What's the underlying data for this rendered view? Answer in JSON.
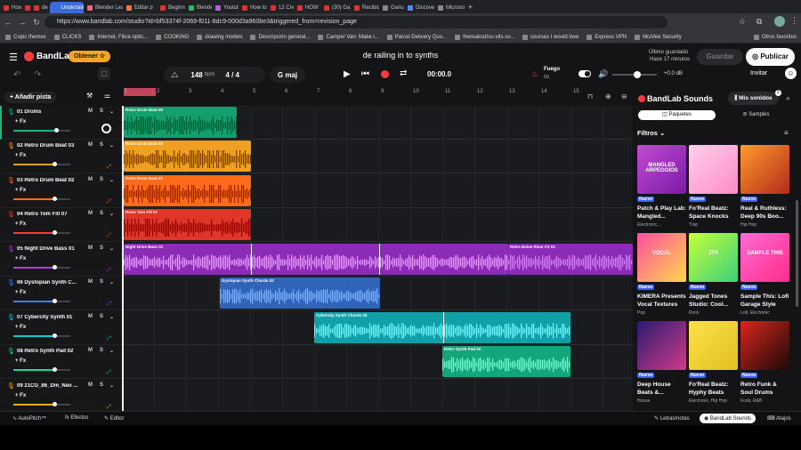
{
  "browser": {
    "tabs": [
      {
        "title": "How To",
        "color": "#d33"
      },
      {
        "title": "",
        "color": "#d33"
      },
      {
        "title": "de",
        "color": "#d33"
      },
      {
        "title": "Undertale DS",
        "color": "#3b6bd6",
        "active": true
      },
      {
        "title": "Blender Learn",
        "color": "#e67"
      },
      {
        "title": "Editar p",
        "color": "#e74"
      },
      {
        "title": "Beginne",
        "color": "#d33"
      },
      {
        "title": "Blender",
        "color": "#2b6"
      },
      {
        "title": "Youtube",
        "color": "#a6c"
      },
      {
        "title": "How to",
        "color": "#d33"
      },
      {
        "title": "12 Crea",
        "color": "#d33"
      },
      {
        "title": "HOW T",
        "color": "#d33"
      },
      {
        "title": "(30) Ga",
        "color": "#d33"
      },
      {
        "title": "Recibido",
        "color": "#d33"
      },
      {
        "title": "Ganu",
        "color": "#888"
      },
      {
        "title": "Discove",
        "color": "#58f"
      },
      {
        "title": "Microso",
        "color": "#888"
      }
    ],
    "url": "https://www.bandlab.com/studio?id=bf53374f-2069-f011-8dc9-000d3a960be3&triggered_from=revision_page",
    "bookmarks": [
      "Copic themes",
      "CLICKS",
      "Internet, Fibra óptic...",
      "COOKING",
      "drawing models",
      "Descripción general...",
      "Camper Van: Make i...",
      "Parcel Delivery Quo...",
      "thereaksd/so-vits-sv...",
      "courses I would love",
      "Express VPN",
      "McAfee Security"
    ],
    "other_bookmarks": "Otros favoritos"
  },
  "app": {
    "logo": "BandLab",
    "get_label": "Obtener",
    "bpm": "148",
    "bpm_unit": "bpm",
    "time_sig": "4 / 4",
    "key": "G maj",
    "time": "00:00.0",
    "project_title": "de railing in to synths",
    "save_status_1": "Último guardado",
    "save_status_2": "Hace 17 minutos",
    "save_label": "Guardar",
    "publish_label": "Publicar",
    "invite_label": "Invitar",
    "fuego_label": "Fuego",
    "fuego_value": "50",
    "volume_db": "+0.0 dB",
    "add_track": "Añadir pista",
    "colors": {
      "accent": "#f5a623",
      "panel": "#141416"
    }
  },
  "ruler": [
    "1",
    "2",
    "3",
    "4",
    "5",
    "6",
    "7",
    "8",
    "9",
    "10",
    "11",
    "12",
    "13",
    "14",
    "15"
  ],
  "tracks": [
    {
      "name": "01  Drums",
      "color": "#1bb47a",
      "fill": 0.75
    },
    {
      "name": "02  Retro Drum Beat 03",
      "color": "#f0a020",
      "fill": 0.72
    },
    {
      "name": "03  Retro Drum Beat 02",
      "color": "#ff6b1a",
      "fill": 0.72
    },
    {
      "name": "04  Retro Tom Fill 07",
      "color": "#ff3b2f",
      "fill": 0.72
    },
    {
      "name": "05  Night Drive Bass 01",
      "color": "#b040e0",
      "fill": 0.72
    },
    {
      "name": "06  Dystopian Synth C...",
      "color": "#3b82f6",
      "fill": 0.72
    },
    {
      "name": "07  Cybercity Synth 01",
      "color": "#14c8d2",
      "fill": 0.72
    },
    {
      "name": "08  Retro Synth Pad 02",
      "color": "#1ed49a",
      "fill": 0.72
    },
    {
      "name": "09  21CG_86_Dm_Neo ...",
      "color": "#f5a623",
      "fill": 0.72
    }
  ],
  "track_labels": {
    "mute": "M",
    "solo": "S",
    "fx": "+ Fx"
  },
  "clips": [
    {
      "lane": 0,
      "label": "Retro Drum Beat 05"
    },
    {
      "lane": 1,
      "label": "Retro Drum Beat 03"
    },
    {
      "lane": 2,
      "label": "Retro Drum Beat 02"
    },
    {
      "lane": 3,
      "label": "Retro Tom Fill 07"
    },
    {
      "lane": 4,
      "label": "Night Drive Bass 01"
    },
    {
      "lane": 4,
      "label": "Retro Noise Riser FX 01"
    },
    {
      "lane": 5,
      "label": "Dystopian Synth Chords 02"
    },
    {
      "lane": 6,
      "label": "Cybercity Synth Chords 02"
    },
    {
      "lane": 7,
      "label": "Retro Synth Pad 02"
    }
  ],
  "sounds": {
    "title": "BandLab Sounds",
    "my_sounds": "Mis sonidos",
    "tab_packs": "Paquetes",
    "tab_samples": "Samples",
    "filters": "Filtros",
    "badge": "Nuevo",
    "cards": [
      {
        "title": "Patch & Play Lab: Mangled...",
        "genre": "Electronic,...",
        "art": "MANGLED ARPEGGIOS"
      },
      {
        "title": "Fo'Real Beatz: Space Knocks",
        "genre": "Trap",
        "art": ""
      },
      {
        "title": "Real & Ruthless: Deep 90s Boo...",
        "genre": "Hip Hop",
        "art": ""
      },
      {
        "title": "KIMERA Presents Vocal Textures",
        "genre": "Pop",
        "art": "VOCAL"
      },
      {
        "title": "Jagged Tones Studio: Cool...",
        "genre": "Rock",
        "art": "JTS"
      },
      {
        "title": "Sample This: Lofi Garage Style",
        "genre": "Lofi, Electronic",
        "art": "SAMPLE THIS"
      },
      {
        "title": "Deep House Beats &...",
        "genre": "House",
        "art": ""
      },
      {
        "title": "Fo'Real Beatz: Hyphy Beats",
        "genre": "Electronic, Hip Hop",
        "art": ""
      },
      {
        "title": "Retro Funk & Soul Drums",
        "genre": "Funk, R&B",
        "art": ""
      }
    ]
  },
  "bottom": {
    "autopitch": "AutoPitch™",
    "effects": "Efectos",
    "editor": "Editor",
    "lyrics": "Letras/notas",
    "sounds": "BandLab Sounds",
    "shortcuts": "Atajos"
  }
}
